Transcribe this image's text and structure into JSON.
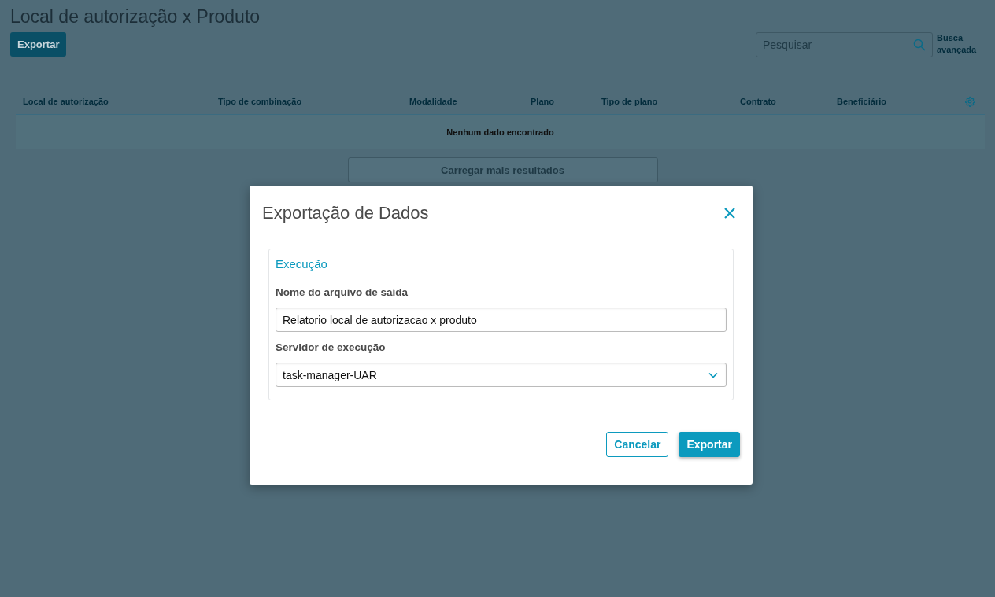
{
  "page": {
    "title": "Local de autorização x Produto",
    "export_button": "Exportar",
    "search": {
      "placeholder": "Pesquisar"
    },
    "advanced_search": "Busca avançada"
  },
  "table": {
    "columns": [
      "Local de autorização",
      "Tipo de combinação",
      "Modalidade",
      "Plano",
      "Tipo de plano",
      "Contrato",
      "Beneficiário"
    ],
    "empty_message": "Nenhum dado encontrado",
    "load_more": "Carregar mais resultados"
  },
  "dialog": {
    "title": "Exportação de Dados",
    "section": {
      "title": "Execução",
      "fields": [
        {
          "kind": "text",
          "label": "Nome do arquivo de saída",
          "value": "Relatorio local de autorizacao x produto"
        },
        {
          "kind": "select",
          "label": "Servidor de execução",
          "value": "task-manager-UAR"
        }
      ]
    },
    "buttons": [
      {
        "label": "Cancelar",
        "kind": "secondary"
      },
      {
        "label": "Exportar",
        "kind": "primary"
      }
    ]
  }
}
